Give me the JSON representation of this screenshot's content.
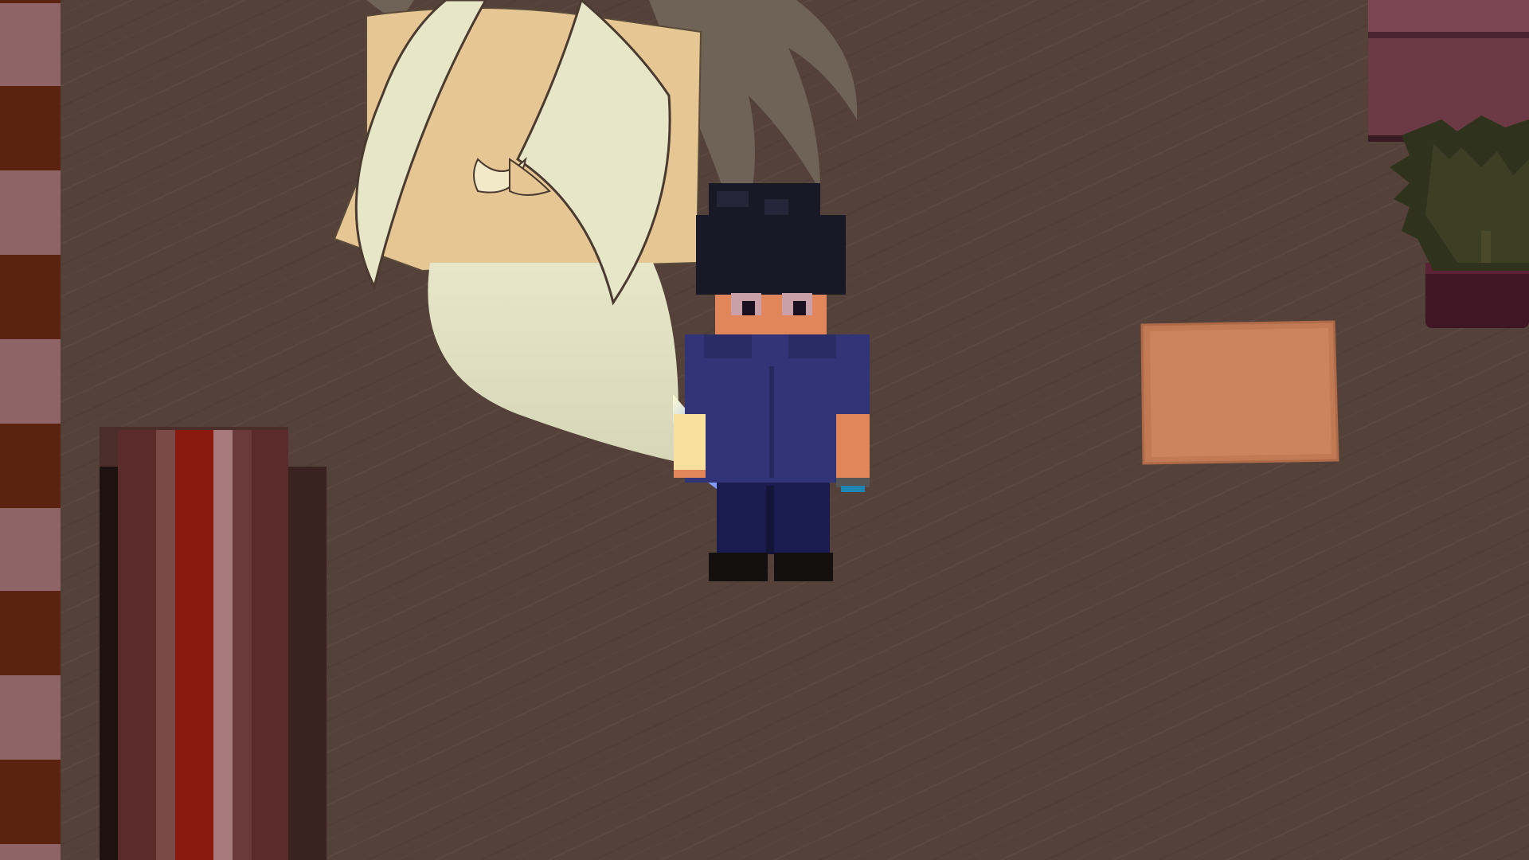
{
  "scene": {
    "floor_color": "#54423a",
    "wall_stripe_colors": [
      "#5c2210",
      "#8f6466"
    ],
    "pillar_colors": [
      "#2a1b17",
      "#5a2b2a",
      "#8a1a10",
      "#a67a7a",
      "#6a3a3a"
    ],
    "player": {
      "hair_color": "#181826",
      "skin_color": "#e0865a",
      "shirt_color": "#323478",
      "pants_color": "#1a1c50",
      "shoes_color": "#141010",
      "wristband_color": "#1f86b4"
    },
    "ghost": {
      "body_color": "#ddddc0",
      "collar_color": "#e6c794",
      "hair_color": "#6e6356",
      "trail_color": "#4a6bff"
    },
    "rug_color": "#c27a55",
    "plant": {
      "leaf_color": "#2f321c",
      "pot_color": "#3e1624"
    },
    "furniture_color": "#6c3a44"
  }
}
